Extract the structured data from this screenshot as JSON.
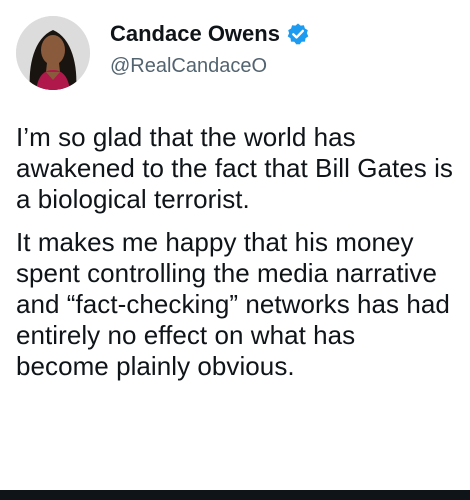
{
  "author": {
    "display_name": "Candace Owens",
    "handle": "@RealCandaceO",
    "verified": true,
    "verified_color": "#1d9bf0",
    "avatar_icon": "profile-photo"
  },
  "tweet": {
    "paragraphs": [
      "I’m so glad that the world has awakened to the fact that Bill Gates is a biological terrorist.",
      "It makes me happy that his money spent controlling the media narrative and “fact-checking” networks has had entirely no effect on what has become plainly obvious."
    ]
  }
}
